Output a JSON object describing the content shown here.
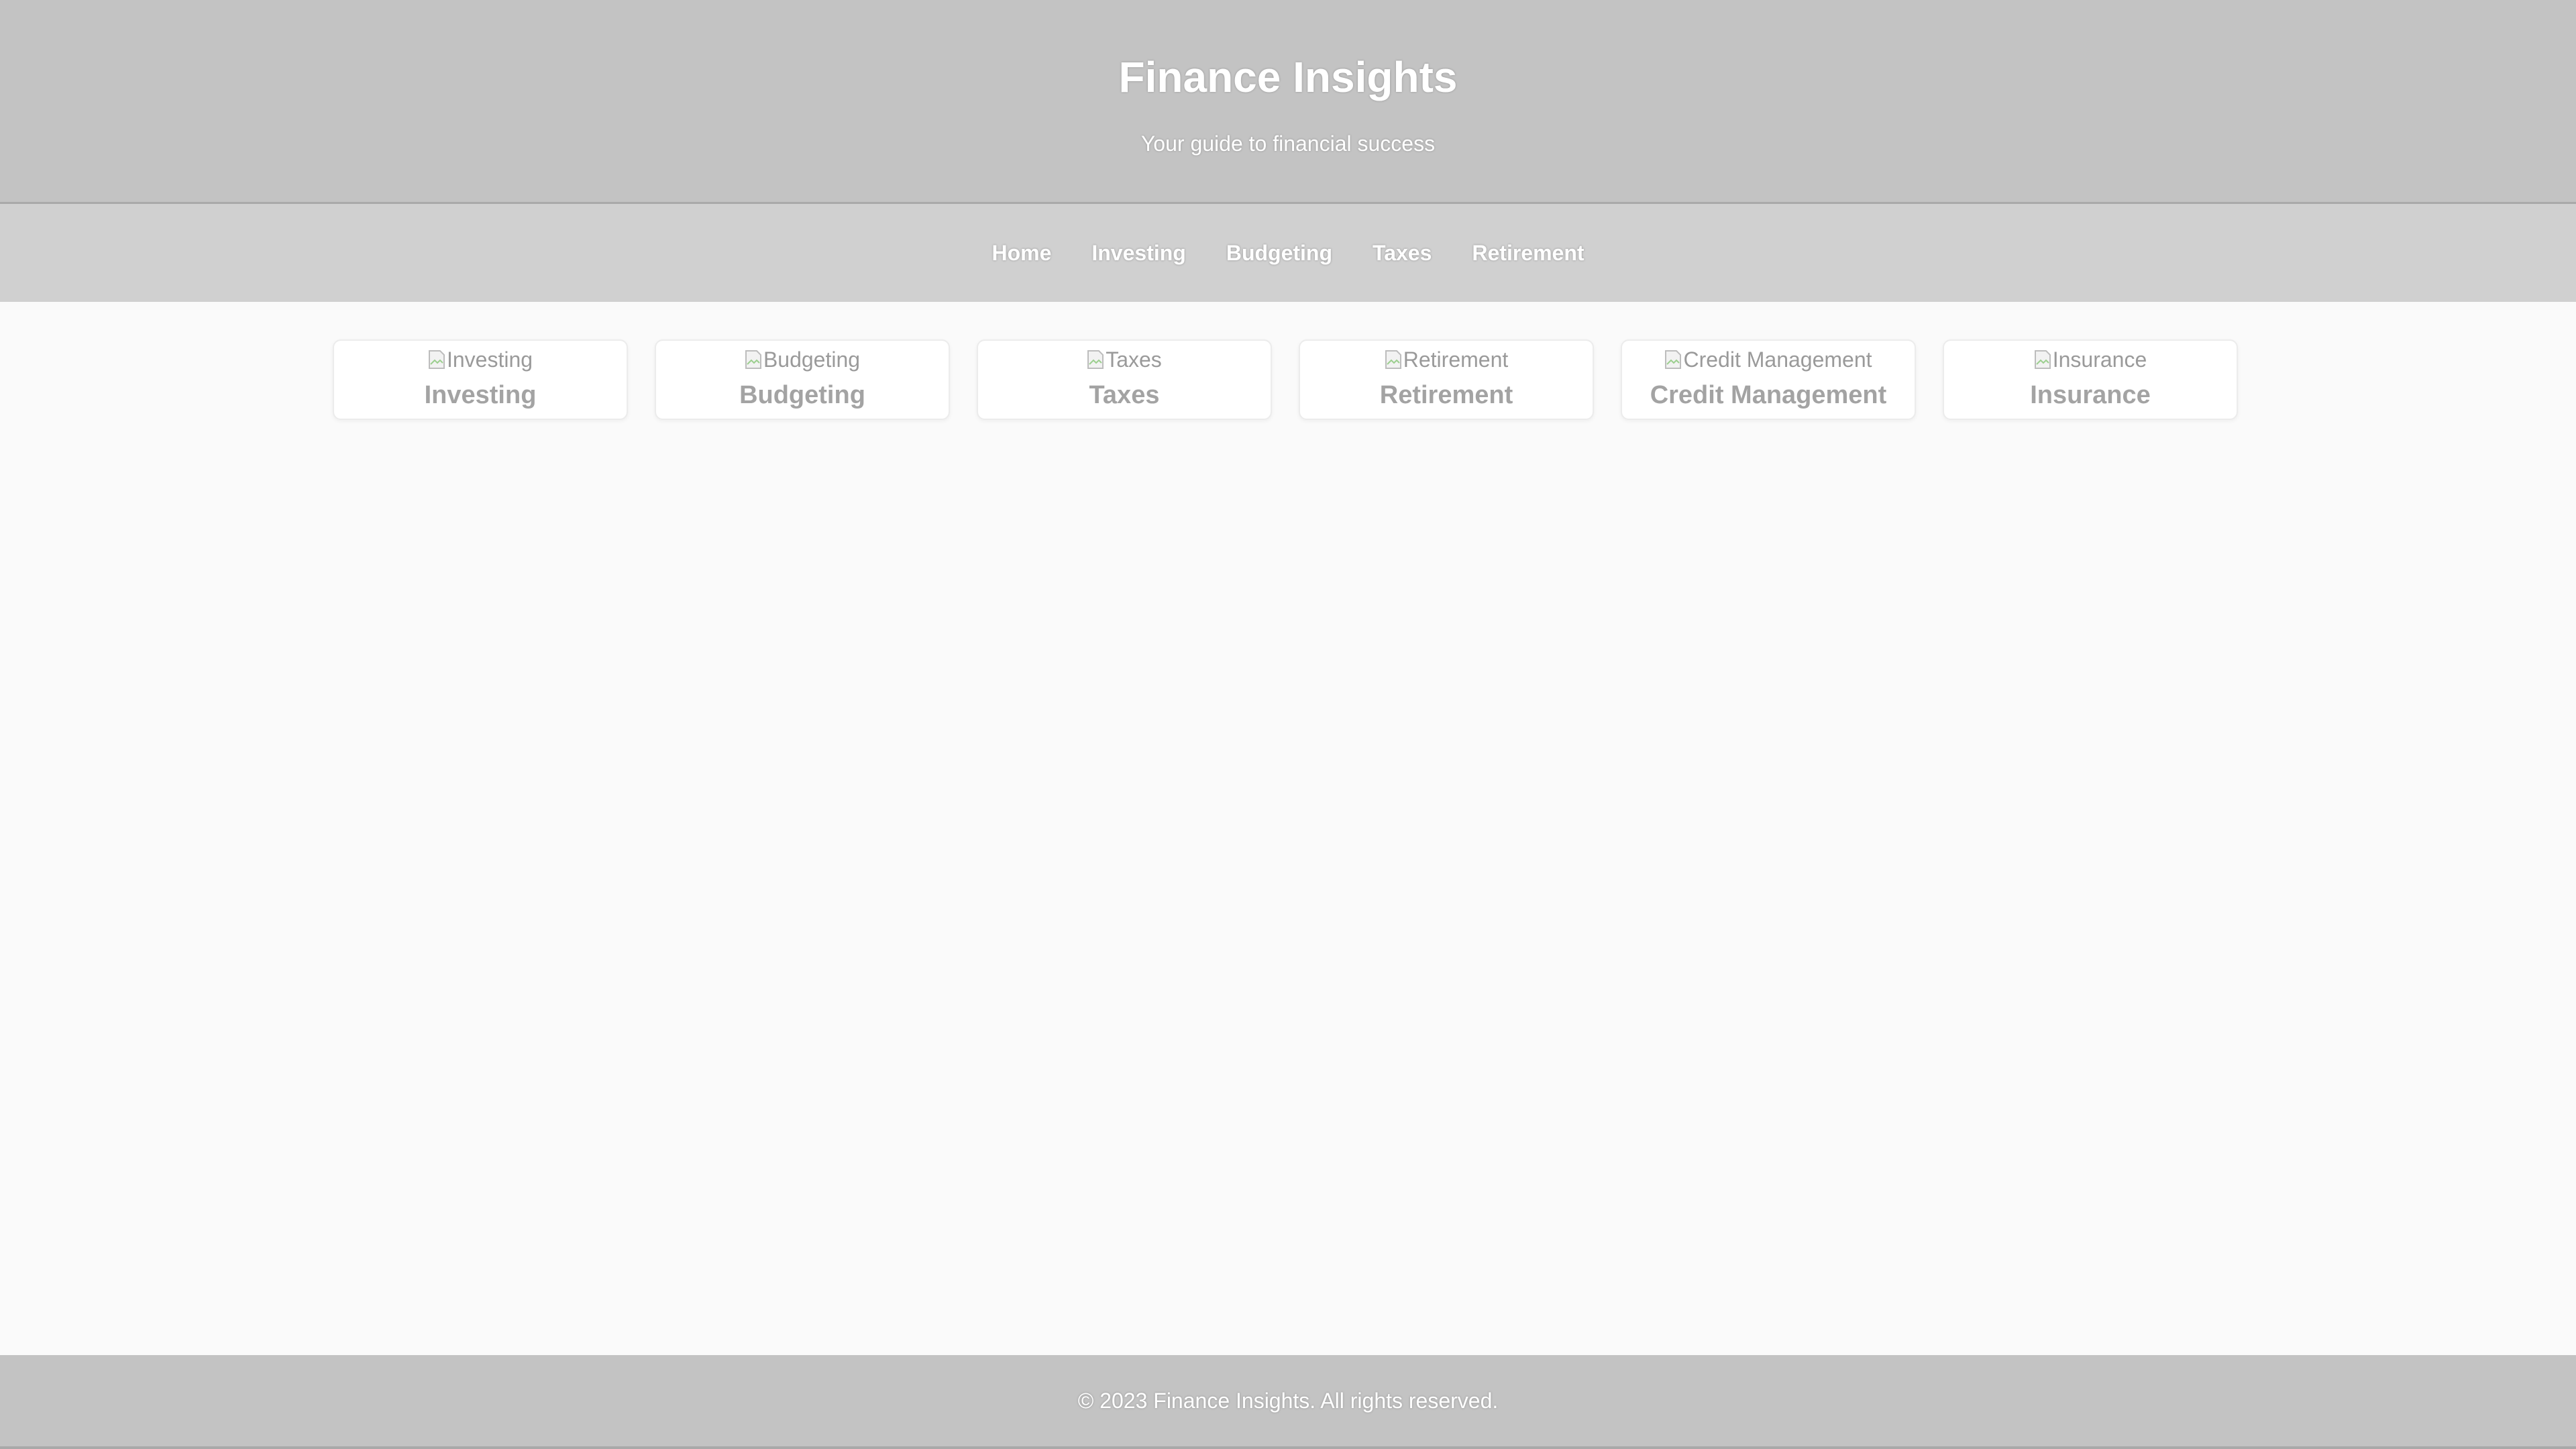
{
  "header": {
    "title": "Finance Insights",
    "tagline": "Your guide to financial success"
  },
  "nav": {
    "items": [
      "Home",
      "Investing",
      "Budgeting",
      "Taxes",
      "Retirement"
    ]
  },
  "cards": [
    {
      "image_alt": "Investing",
      "title": "Investing"
    },
    {
      "image_alt": "Budgeting",
      "title": "Budgeting"
    },
    {
      "image_alt": "Taxes",
      "title": "Taxes"
    },
    {
      "image_alt": "Retirement",
      "title": "Retirement"
    },
    {
      "image_alt": "Credit Management",
      "title": "Credit Management"
    },
    {
      "image_alt": "Insurance",
      "title": "Insurance"
    }
  ],
  "footer": {
    "text": "© 2023 Finance Insights. All rights reserved."
  },
  "colors": {
    "header_bg": "#c3c3c3",
    "nav_bg": "#d0d0d0",
    "page_bg": "#fafafa",
    "card_bg": "#ffffff",
    "card_title": "#a3a3a3"
  }
}
